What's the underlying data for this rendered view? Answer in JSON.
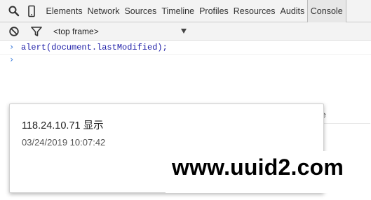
{
  "devtools": {
    "tabs": [
      {
        "label": "Elements"
      },
      {
        "label": "Network"
      },
      {
        "label": "Sources"
      },
      {
        "label": "Timeline"
      },
      {
        "label": "Profiles"
      },
      {
        "label": "Resources"
      },
      {
        "label": "Audits"
      },
      {
        "label": "Console",
        "active": true
      }
    ],
    "icons": {
      "inspect": "search-icon",
      "device": "mobile-device-icon",
      "clear": "clear-console-icon",
      "filter": "filter-icon",
      "frame_dropdown": "chevron-down-icon"
    }
  },
  "console": {
    "frame_select": "<top frame>",
    "prompt_glyph": "›",
    "command": "alert(document.lastModified);",
    "clipped_text": "e",
    "accent_color": "#3879d9"
  },
  "alert_dialog": {
    "title": "118.24.10.71 显示",
    "message": "03/24/2019 10:07:42"
  },
  "watermark": {
    "text": "www.uuid2.com"
  }
}
